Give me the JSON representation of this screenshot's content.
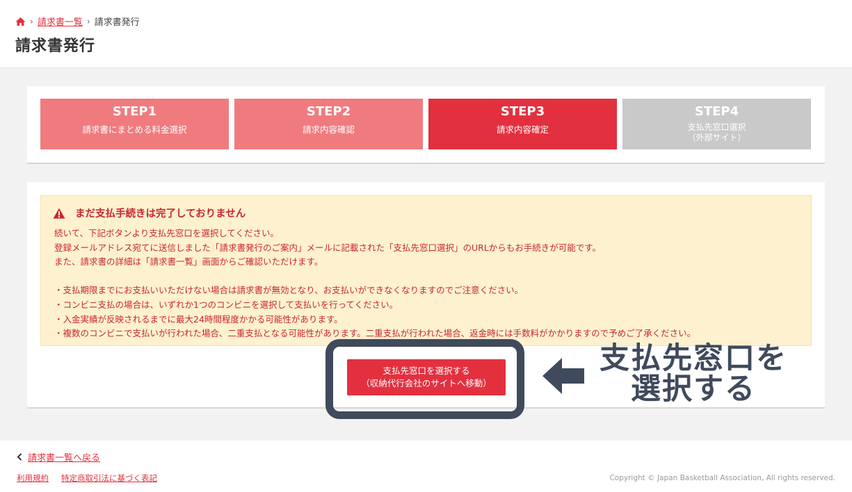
{
  "breadcrumb": {
    "home_icon": "home-icon",
    "invoice_list": "請求書一覧",
    "current": "請求書発行"
  },
  "page_title": "請求書発行",
  "colors": {
    "accent": "#e3303f",
    "step_done": "#f07b7f",
    "step_active": "#e3303f",
    "step_pending": "#c9c9c9",
    "notice_bg": "#fdf1cf",
    "callout": "#3f4a5c"
  },
  "steps": [
    {
      "num": "STEP1",
      "label": "請求書にまとめる料金選択",
      "state": "done"
    },
    {
      "num": "STEP2",
      "label": "請求内容確認",
      "state": "done"
    },
    {
      "num": "STEP3",
      "label": "請求内容確定",
      "state": "active"
    },
    {
      "num": "STEP4",
      "label_line1": "支払先窓口選択",
      "label_line2": "（外部サイト）",
      "state": "pending"
    }
  ],
  "notice": {
    "title": "まだ支払手続きは完了しておりません",
    "lines": [
      "続いて、下記ボタンより支払先窓口を選択してください。",
      "登録メールアドレス宛てに送信しました「請求書発行のご案内」メールに記載された「支払先窓口選択」のURLからもお手続きが可能です。",
      "また、請求書の詳細は「請求書一覧」画面からご確認いただけます。"
    ],
    "bullets": [
      "・支払期限までにお支払いいただけない場合は請求書が無効となり、お支払いができなくなりますのでご注意ください。",
      "・コンビニ支払の場合は、いずれか1つのコンビニを選択して支払いを行ってください。",
      "・入金実績が反映されるまでに最大24時間程度かかる可能性があります。",
      "・複数のコンビニで支払いが行われた場合、二重支払となる可能性があります。二重支払が行われた場合、返金時には手数料がかかりますので予めご了承ください。"
    ]
  },
  "cta": {
    "line1": "支払先窓口を選択する",
    "line2": "（収納代行会社のサイトへ移動）"
  },
  "callout": {
    "line1": "支払先窓口を",
    "line2": "選択する"
  },
  "footer": {
    "back": "請求書一覧へ戻る",
    "terms": "利用規約",
    "commerce_law": "特定商取引法に基づく表記",
    "copyright": "Copyright © Japan Basketball Association, All rights reserved."
  }
}
